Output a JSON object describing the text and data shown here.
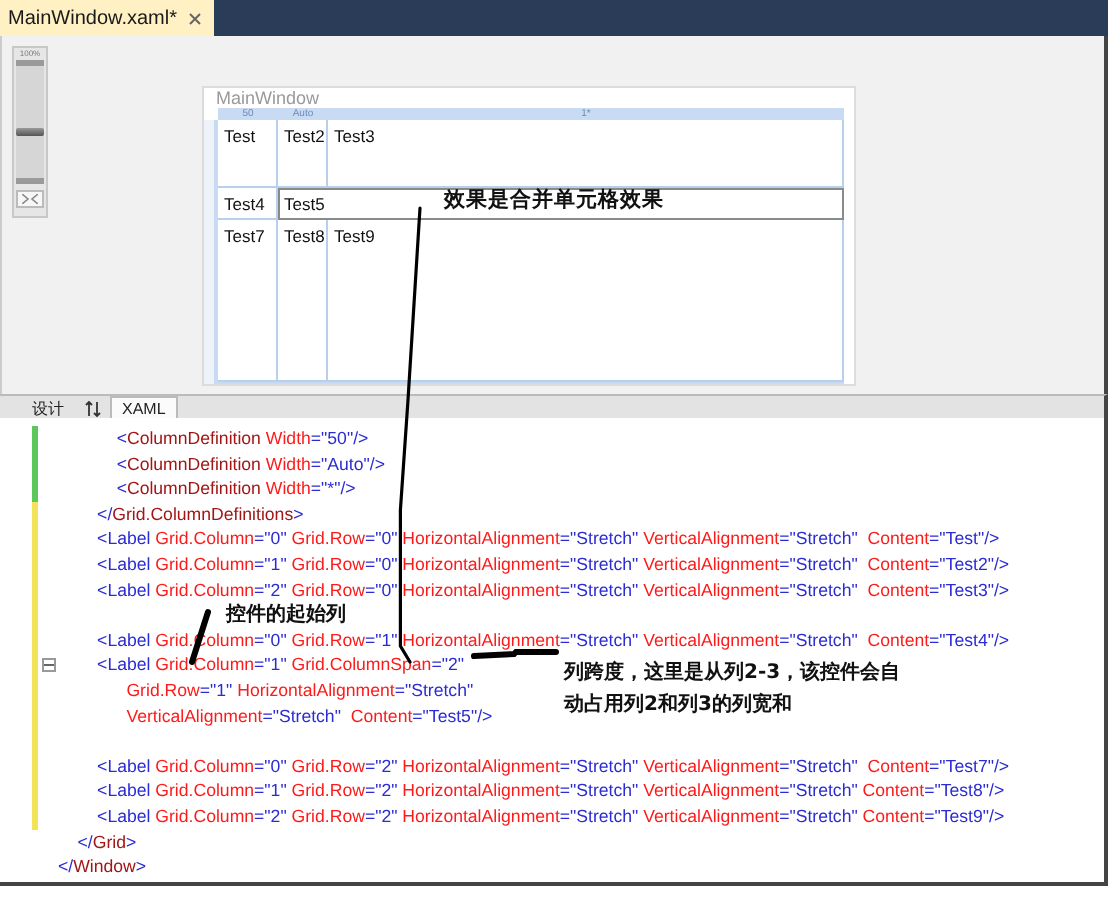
{
  "document_tab": {
    "title": "MainWindow.xaml*",
    "selected": true
  },
  "zoom": {
    "label": "100%",
    "level": 0.4
  },
  "designer": {
    "window_title": "MainWindow",
    "column_rulers": [
      "50",
      "Auto",
      "1*"
    ],
    "rows": [
      {
        "cells": [
          {
            "text": "Test",
            "kind": "single",
            "selected": false
          },
          {
            "text": "Test2",
            "kind": "single",
            "selected": false
          },
          {
            "text": "Test3",
            "kind": "single",
            "selected": false
          }
        ]
      },
      {
        "cells": [
          {
            "text": "Test4",
            "kind": "single",
            "selected": false
          },
          {
            "text": "Test5",
            "kind": "merged",
            "selected": true
          }
        ]
      },
      {
        "cells": [
          {
            "text": "Test7",
            "kind": "single",
            "selected": false
          },
          {
            "text": "Test8",
            "kind": "single",
            "selected": false
          },
          {
            "text": "Test9",
            "kind": "single",
            "selected": false
          }
        ]
      }
    ],
    "annotation": "效果是合并单元格效果"
  },
  "view_tabs": [
    {
      "label": "设计",
      "selected": false
    },
    {
      "label": "XAML",
      "selected": true
    }
  ],
  "editor": {
    "lines": [
      {
        "changed": true,
        "saved": true,
        "collapse": false,
        "tokens": [
          {
            "kind": "tag",
            "text": "            <"
          },
          {
            "kind": "element",
            "text": "ColumnDefinition"
          },
          {
            "kind": "attr",
            "text": " Width"
          },
          {
            "kind": "value",
            "text": "=\"50\"/>"
          }
        ]
      },
      {
        "changed": true,
        "saved": true,
        "collapse": false,
        "tokens": [
          {
            "kind": "tag",
            "text": "            <"
          },
          {
            "kind": "element",
            "text": "ColumnDefinition"
          },
          {
            "kind": "attr",
            "text": " Width"
          },
          {
            "kind": "value",
            "text": "=\"Auto\"/>"
          }
        ]
      },
      {
        "changed": true,
        "saved": true,
        "collapse": false,
        "tokens": [
          {
            "kind": "tag",
            "text": "            <"
          },
          {
            "kind": "element",
            "text": "ColumnDefinition"
          },
          {
            "kind": "attr",
            "text": " Width"
          },
          {
            "kind": "value",
            "text": "=\"*\"/>"
          }
        ]
      },
      {
        "changed": true,
        "saved": false,
        "collapse": false,
        "tokens": [
          {
            "kind": "tag",
            "text": "        </"
          },
          {
            "kind": "element",
            "text": "Grid.ColumnDefinitions"
          },
          {
            "kind": "tag",
            "text": ">"
          }
        ]
      },
      {
        "changed": true,
        "saved": false,
        "collapse": false,
        "tokens": [
          {
            "kind": "tag",
            "text": "        <Label"
          },
          {
            "kind": "attr",
            "text": " Grid.Column"
          },
          {
            "kind": "value",
            "text": "=\"0\""
          },
          {
            "kind": "attr",
            "text": " Grid.Row"
          },
          {
            "kind": "value",
            "text": "=\"0\""
          },
          {
            "kind": "attr",
            "text": " HorizontalAlignment"
          },
          {
            "kind": "value",
            "text": "=\"Stretch\""
          },
          {
            "kind": "attr",
            "text": " VerticalAlignment"
          },
          {
            "kind": "value",
            "text": "=\"Stretch\""
          },
          {
            "kind": "attr",
            "text": "  Content"
          },
          {
            "kind": "value",
            "text": "=\"Test\"/>"
          }
        ]
      },
      {
        "changed": true,
        "saved": false,
        "collapse": false,
        "tokens": [
          {
            "kind": "tag",
            "text": "        <Label"
          },
          {
            "kind": "attr",
            "text": " Grid.Column"
          },
          {
            "kind": "value",
            "text": "=\"1\""
          },
          {
            "kind": "attr",
            "text": " Grid.Row"
          },
          {
            "kind": "value",
            "text": "=\"0\""
          },
          {
            "kind": "attr",
            "text": " HorizontalAlignment"
          },
          {
            "kind": "value",
            "text": "=\"Stretch\""
          },
          {
            "kind": "attr",
            "text": " VerticalAlignment"
          },
          {
            "kind": "value",
            "text": "=\"Stretch\""
          },
          {
            "kind": "attr",
            "text": "  Content"
          },
          {
            "kind": "value",
            "text": "=\"Test2\"/>"
          }
        ]
      },
      {
        "changed": true,
        "saved": false,
        "collapse": false,
        "tokens": [
          {
            "kind": "tag",
            "text": "        <Label"
          },
          {
            "kind": "attr",
            "text": " Grid.Column"
          },
          {
            "kind": "value",
            "text": "=\"2\""
          },
          {
            "kind": "attr",
            "text": " Grid.Row"
          },
          {
            "kind": "value",
            "text": "=\"0\""
          },
          {
            "kind": "attr",
            "text": " HorizontalAlignment"
          },
          {
            "kind": "value",
            "text": "=\"Stretch\""
          },
          {
            "kind": "attr",
            "text": " VerticalAlignment"
          },
          {
            "kind": "value",
            "text": "=\"Stretch\""
          },
          {
            "kind": "attr",
            "text": "  Content"
          },
          {
            "kind": "value",
            "text": "=\"Test3\"/>"
          }
        ]
      },
      {
        "changed": true,
        "saved": false,
        "collapse": false
      },
      {
        "changed": true,
        "saved": false,
        "collapse": false,
        "tokens": [
          {
            "kind": "tag",
            "text": "        <Label"
          },
          {
            "kind": "attr",
            "text": " Grid.Column"
          },
          {
            "kind": "value",
            "text": "=\"0\""
          },
          {
            "kind": "attr",
            "text": " Grid.Row"
          },
          {
            "kind": "value",
            "text": "=\"1\""
          },
          {
            "kind": "attr",
            "text": " HorizontalAlignment"
          },
          {
            "kind": "value",
            "text": "=\"Stretch\""
          },
          {
            "kind": "attr",
            "text": " VerticalAlignment"
          },
          {
            "kind": "value",
            "text": "=\"Stretch\""
          },
          {
            "kind": "attr",
            "text": "  Content"
          },
          {
            "kind": "value",
            "text": "=\"Test4\"/>"
          }
        ]
      },
      {
        "changed": true,
        "saved": false,
        "collapse": true,
        "tokens": [
          {
            "kind": "tag",
            "text": "        <Label"
          },
          {
            "kind": "attr",
            "text": " Grid.Column"
          },
          {
            "kind": "value",
            "text": "=\"1\""
          },
          {
            "kind": "attr",
            "text": " Grid.ColumnSpan"
          },
          {
            "kind": "value",
            "text": "=\"2\""
          }
        ]
      },
      {
        "changed": true,
        "saved": false,
        "collapse": false,
        "tokens": [
          {
            "kind": "attr",
            "text": "              Grid.Row"
          },
          {
            "kind": "value",
            "text": "=\"1\""
          },
          {
            "kind": "attr",
            "text": " HorizontalAlignment"
          },
          {
            "kind": "value",
            "text": "=\"Stretch\""
          }
        ]
      },
      {
        "changed": true,
        "saved": false,
        "collapse": false,
        "tokens": [
          {
            "kind": "attr",
            "text": "              VerticalAlignment"
          },
          {
            "kind": "value",
            "text": "=\"Stretch\""
          },
          {
            "kind": "attr",
            "text": "  Content"
          },
          {
            "kind": "value",
            "text": "=\"Test5\"/>"
          }
        ]
      },
      {
        "changed": true,
        "saved": false,
        "collapse": false
      },
      {
        "changed": true,
        "saved": false,
        "collapse": false,
        "tokens": [
          {
            "kind": "tag",
            "text": "        <Label"
          },
          {
            "kind": "attr",
            "text": " Grid.Column"
          },
          {
            "kind": "value",
            "text": "=\"0\""
          },
          {
            "kind": "attr",
            "text": " Grid.Row"
          },
          {
            "kind": "value",
            "text": "=\"2\""
          },
          {
            "kind": "attr",
            "text": " HorizontalAlignment"
          },
          {
            "kind": "value",
            "text": "=\"Stretch\""
          },
          {
            "kind": "attr",
            "text": " VerticalAlignment"
          },
          {
            "kind": "value",
            "text": "=\"Stretch\""
          },
          {
            "kind": "attr",
            "text": "  Content"
          },
          {
            "kind": "value",
            "text": "=\"Test7\"/>"
          }
        ]
      },
      {
        "changed": true,
        "saved": false,
        "collapse": false,
        "tokens": [
          {
            "kind": "tag",
            "text": "        <Label"
          },
          {
            "kind": "attr",
            "text": " Grid.Column"
          },
          {
            "kind": "value",
            "text": "=\"1\""
          },
          {
            "kind": "attr",
            "text": " Grid.Row"
          },
          {
            "kind": "value",
            "text": "=\"2\""
          },
          {
            "kind": "attr",
            "text": " HorizontalAlignment"
          },
          {
            "kind": "value",
            "text": "=\"Stretch\""
          },
          {
            "kind": "attr",
            "text": " VerticalAlignment"
          },
          {
            "kind": "value",
            "text": "=\"Stretch\""
          },
          {
            "kind": "attr",
            "text": " Content"
          },
          {
            "kind": "value",
            "text": "=\"Test8\"/>"
          }
        ]
      },
      {
        "changed": true,
        "saved": false,
        "collapse": false,
        "tokens": [
          {
            "kind": "tag",
            "text": "        <Label"
          },
          {
            "kind": "attr",
            "text": " Grid.Column"
          },
          {
            "kind": "value",
            "text": "=\"2\""
          },
          {
            "kind": "attr",
            "text": " Grid.Row"
          },
          {
            "kind": "value",
            "text": "=\"2\""
          },
          {
            "kind": "attr",
            "text": " HorizontalAlignment"
          },
          {
            "kind": "value",
            "text": "=\"Stretch\""
          },
          {
            "kind": "attr",
            "text": " VerticalAlignment"
          },
          {
            "kind": "value",
            "text": "=\"Stretch\""
          },
          {
            "kind": "attr",
            "text": " Content"
          },
          {
            "kind": "value",
            "text": "=\"Test9\"/>"
          }
        ]
      },
      {
        "changed": false,
        "collapse": false,
        "tokens": [
          {
            "kind": "tag",
            "text": "    </"
          },
          {
            "kind": "element",
            "text": "Grid"
          },
          {
            "kind": "tag",
            "text": ">"
          }
        ]
      },
      {
        "changed": false,
        "collapse": false,
        "tokens": [
          {
            "kind": "tag",
            "text": "</"
          },
          {
            "kind": "element",
            "text": "Window"
          },
          {
            "kind": "tag",
            "text": ">"
          }
        ]
      }
    ]
  },
  "notes": [
    {
      "text": "控件的起始列"
    },
    {
      "text": "列跨度，这里是从列2-3，该控件会自动占用列2和列3的列宽和"
    }
  ]
}
